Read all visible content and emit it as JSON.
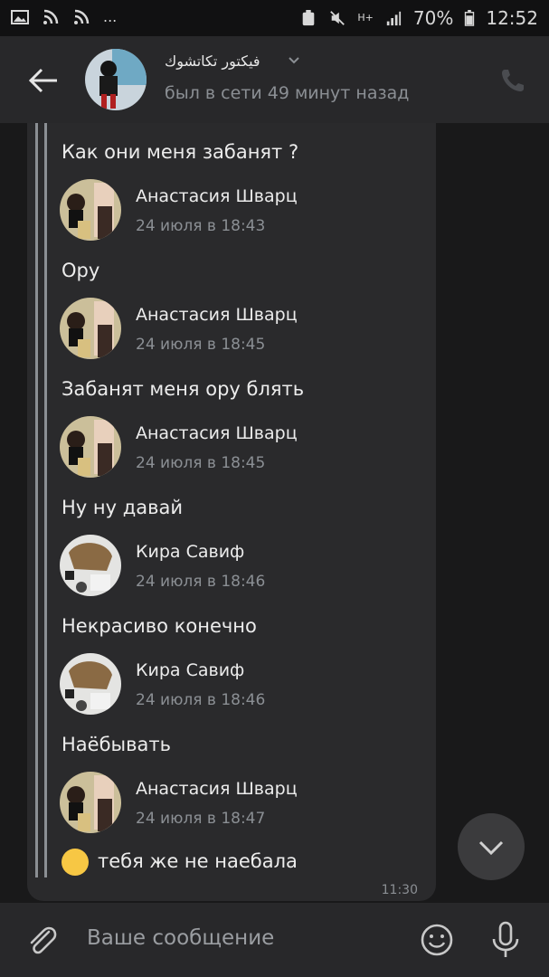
{
  "status_bar": {
    "battery": "70%",
    "time": "12:52",
    "net": "H+",
    "dots": "..."
  },
  "header": {
    "name": "فيكتور تكاتشوك",
    "status": "был в сети 49 минут назад"
  },
  "messages": [
    {
      "type": "text",
      "text": "Как они меня забанят ?"
    },
    {
      "type": "forward",
      "author": "Анастасия Шварц",
      "date": "24 июля в 18:43"
    },
    {
      "type": "text",
      "text": "Ору"
    },
    {
      "type": "forward",
      "author": "Анастасия Шварц",
      "date": "24 июля в 18:45"
    },
    {
      "type": "text",
      "text": "Забанят меня ору блять"
    },
    {
      "type": "forward",
      "author": "Анастасия Шварц",
      "date": "24 июля в 18:45"
    },
    {
      "type": "text",
      "text": "Ну ну давай"
    },
    {
      "type": "forward",
      "author": "Кира Савиф",
      "date": "24 июля в 18:46"
    },
    {
      "type": "text",
      "text": "Некрасиво конечно"
    },
    {
      "type": "forward",
      "author": "Кира Савиф",
      "date": "24 июля в 18:46"
    },
    {
      "type": "text",
      "text": "Наёбывать"
    },
    {
      "type": "forward",
      "author": "Анастасия Шварц",
      "date": "24 июля в 18:47"
    },
    {
      "type": "text",
      "text": "тебя же не наебала"
    }
  ],
  "bubble_time": "11:30",
  "input": {
    "placeholder": "Ваше сообщение"
  }
}
